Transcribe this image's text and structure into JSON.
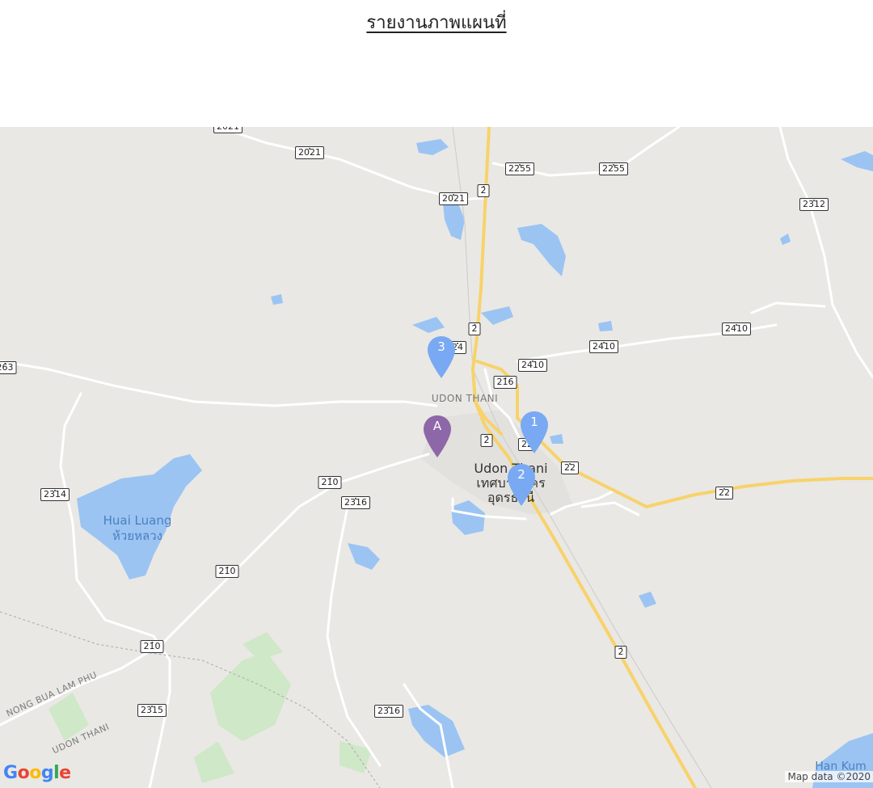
{
  "report": {
    "title": "รายงานภาพแผนที่"
  },
  "map": {
    "place_labels": {
      "udon_thani_en": "Udon Thani",
      "udon_thani_th1": "เทศบาลนคร",
      "udon_thani_th2": "อุดรธานี",
      "udon_thani_caps": "UDON THANI",
      "huai_luang_en": "Huai Luang",
      "huai_luang_th": "ห้วยหลวง",
      "nong_bua_lam_phu": "NONG BUA LAM PHU",
      "udon_thani_district": "UDON THANI",
      "han_kumpawapi": "Han Kum"
    },
    "road_shields": [
      "2021",
      "2021",
      "2021",
      "2255",
      "2255",
      "2",
      "2312",
      "2",
      "24",
      "2410",
      "2410",
      "2410",
      "216",
      "263",
      "2",
      "22",
      "22",
      "22",
      "2314",
      "210",
      "2316",
      "210",
      "210",
      "2315",
      "2316",
      "2"
    ],
    "markers": [
      {
        "label": "A",
        "color": "#8e67a9"
      },
      {
        "label": "1",
        "color": "#79a9f2"
      },
      {
        "label": "2",
        "color": "#79a9f2"
      },
      {
        "label": "3",
        "color": "#79a9f2"
      }
    ],
    "attribution": {
      "logo": "Google",
      "copyright": "Map data ©2020"
    },
    "colors": {
      "land": "#e9e8e4",
      "water": "#9bc4f3",
      "highway": "#f8d26a",
      "road": "#ffffff",
      "park": "#c8e6c0"
    }
  }
}
